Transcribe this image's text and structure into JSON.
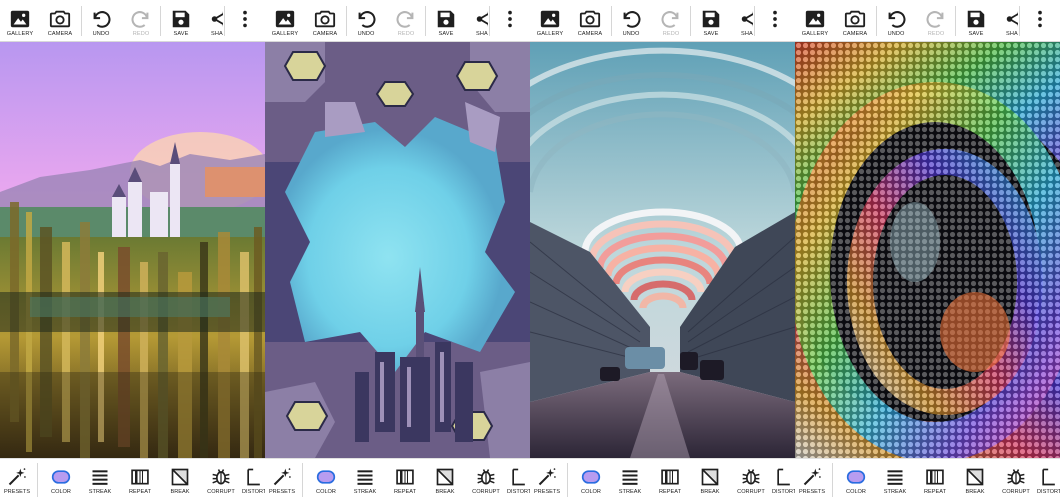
{
  "top_toolbar": {
    "gallery_label": "GALLERY",
    "camera_label": "CAMERA",
    "undo_label": "UNDO",
    "redo_label": "REDO",
    "save_label": "SAVE",
    "share_label": "SHARE"
  },
  "bottom_toolbar": {
    "presets_label": "PRESETS",
    "color_label": "COLOR",
    "streak_label": "STREAK",
    "repeat_label": "REPEAT",
    "break_label": "BREAK",
    "corrupt_label": "CORRUPT",
    "distort_label": "DISTORT"
  },
  "colors": {
    "toolbar_bg": "#ffffff",
    "icon": "#1f1f1f",
    "icon_disabled": "#b5b5b5",
    "color_tool_fill": "#b89cf0",
    "color_tool_stroke": "#2a6de0"
  },
  "panels": [
    {
      "image": "glitched castle landscape"
    },
    {
      "image": "kaleidoscope city skyline"
    },
    {
      "image": "curved street with arches"
    },
    {
      "image": "rainbow dot vortex"
    }
  ]
}
